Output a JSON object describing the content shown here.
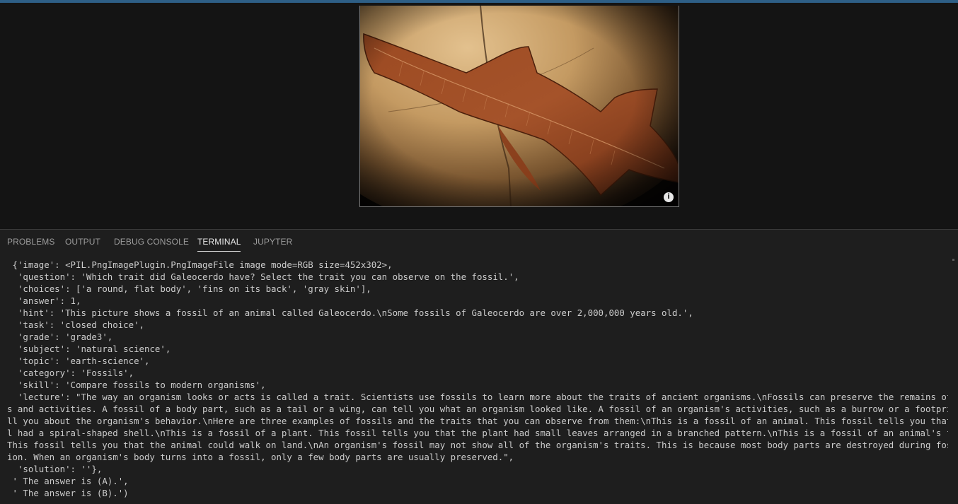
{
  "panel": {
    "tabs": [
      {
        "label": "PROBLEMS"
      },
      {
        "label": "OUTPUT"
      },
      {
        "label": "DEBUG CONSOLE"
      },
      {
        "label": "TERMINAL"
      },
      {
        "label": "JUPYTER"
      }
    ],
    "active_tab": "TERMINAL"
  },
  "image_viewer": {
    "subject": "fossil of Galeocerdo (shark) embedded in rock",
    "info_icon": "info-icon",
    "info_glyph": "i"
  },
  "terminal": {
    "lines": [
      "{'image': <PIL.PngImagePlugin.PngImageFile image mode=RGB size=452x302>,",
      " 'question': 'Which trait did Galeocerdo have? Select the trait you can observe on the fossil.',",
      " 'choices': ['a round, flat body', 'fins on its back', 'gray skin'],",
      " 'answer': 1,",
      " 'hint': 'This picture shows a fossil of an animal called Galeocerdo.\\nSome fossils of Galeocerdo are over 2,000,000 years old.',",
      " 'task': 'closed choice',",
      " 'grade': 'grade3',",
      " 'subject': 'natural science',",
      " 'topic': 'earth-science',",
      " 'category': 'Fossils',",
      " 'skill': 'Compare fossils to modern organisms',",
      " 'lecture': \"The way an organism looks or acts is called a trait. Scientists use fossils to learn more about the traits of ancient organisms.\\nFossils can preserve the remains of body part",
      "s and activities. A fossil of a body part, such as a tail or a wing, can tell you what an organism looked like. A fossil of an organism's activities, such as a burrow or a footprint, can te",
      "ll you about the organism's behavior.\\nHere are three examples of fossils and the traits that you can observe from them:\\nThis is a fossil of an animal. This fossil tells you that the anima",
      "l had a spiral-shaped shell.\\nThis is a fossil of a plant. This fossil tells you that the plant had small leaves arranged in a branched pattern.\\nThis is a fossil of an animal's footprint.",
      "This fossil tells you that the animal could walk on land.\\nAn organism's fossil may not show all of the organism's traits. This is because most body parts are destroyed during fossil format",
      "ion. When an organism's body turns into a fossil, only a few body parts are usually preserved.\",",
      " 'solution': ''},",
      "' The answer is (A).',",
      "' The answer is (B).')"
    ],
    "indents": [
      1,
      1,
      1,
      1,
      1,
      1,
      1,
      1,
      1,
      1,
      1,
      1,
      0,
      0,
      0,
      0,
      0,
      1,
      1,
      1
    ]
  },
  "colors": {
    "accent": "#2e5f86",
    "terminal_bg": "#1e1e1e",
    "terminal_text": "#cccccc",
    "tab_inactive": "#9d9d9d",
    "tab_active": "#e7e7e7"
  }
}
